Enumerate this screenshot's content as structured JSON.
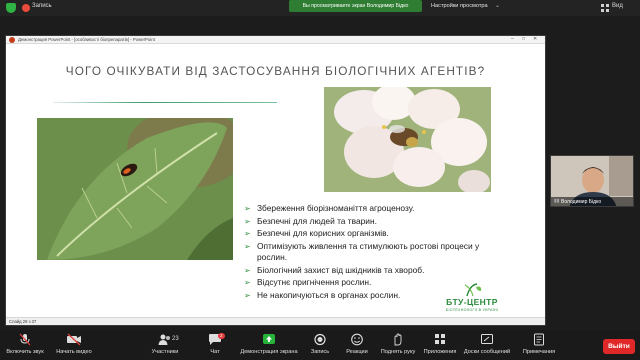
{
  "topbar": {
    "recording_label": "Запись",
    "sharing_banner": "Вы просматриваете экран Володимир Бідко",
    "view_options": "Настройки просмотра",
    "view_button": "Вид"
  },
  "powerpoint": {
    "window_title": "Демонстрация PowerPoint - [особливості біопрепаратів] - PowerPoint",
    "status_slide": "Слайд 29 з 37"
  },
  "slide": {
    "title": "ЧОГО ОЧІКУВАТИ ВІД ЗАСТОСУВАННЯ БІОЛОГІЧНИХ АГЕНТІВ?",
    "bullets": [
      "Збереження біорізноманіття агроценозу.",
      "Безпечні для людей та тварин.",
      "Безпечні для корисних організмів.",
      "Оптимізують живлення та стимулюють ростові процеси у рослин.",
      "Біологічний захист від шкідників та хвороб.",
      "Відсутнє пригнічення рослин.",
      "Не накопичуються в органах рослин."
    ],
    "logo": {
      "name": "БТУ-ЦЕНТР",
      "subtitle": "БІОТЕХНОЛОГІЇ В УКРАЇНІ"
    }
  },
  "participant": {
    "name": "Володимир Бідко"
  },
  "toolbar": {
    "mute": "Включить звук",
    "video": "Начать видео",
    "participants": "Участники",
    "participants_count": "23",
    "chat": "Чат",
    "chat_badge": "2",
    "share": "Демонстрация экрана",
    "record": "Запись",
    "reactions": "Реакции",
    "raise_hand": "Поднять руку",
    "apps": "Приложения",
    "whiteboard": "Доски сообщений",
    "notes": "Примечания",
    "end": "Выйти"
  },
  "colors": {
    "accent_green": "#2e7d32",
    "end_red": "#e02828",
    "bullet_green": "#2a8a3a"
  }
}
